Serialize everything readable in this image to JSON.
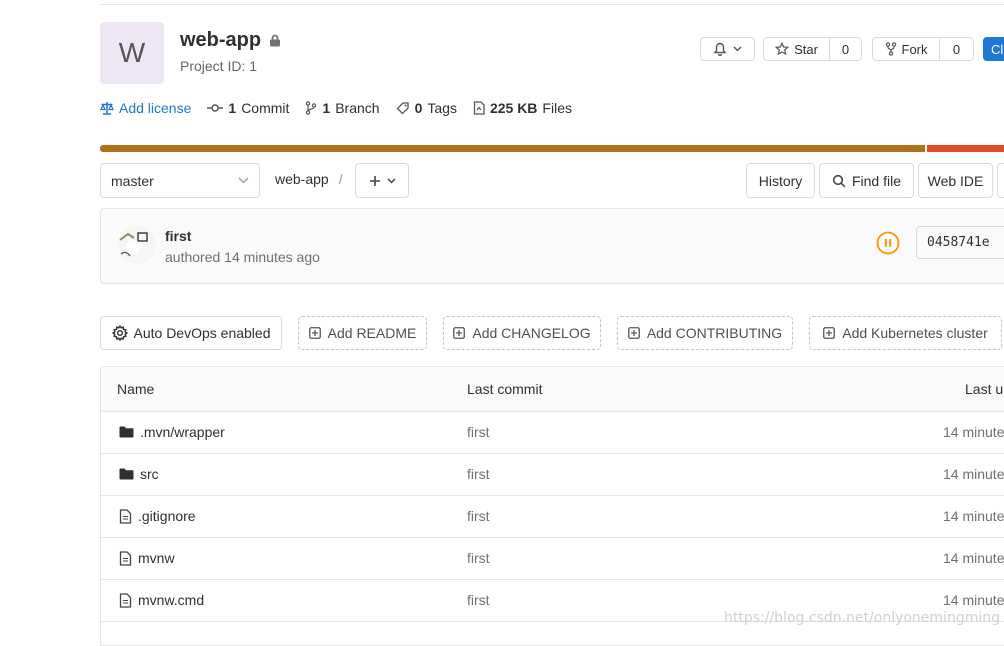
{
  "project": {
    "avatar_letter": "W",
    "name": "web-app",
    "id_text": "Project ID: 1"
  },
  "actions": {
    "star_label": "Star",
    "star_count": "0",
    "fork_label": "Fork",
    "fork_count": "0",
    "clone_partial": "Cl"
  },
  "stats": {
    "add_license": "Add license",
    "commits_num": "1",
    "commits_label": "Commit",
    "branches_num": "1",
    "branches_label": "Branch",
    "tags_num": "0",
    "tags_label": "Tags",
    "files_size": "225 KB",
    "files_label": "Files"
  },
  "language_colors": {
    "java": "#b07219",
    "html": "#e34c26"
  },
  "toolbar": {
    "branch": "master",
    "path": "web-app",
    "separator": "/",
    "history": "History",
    "find_file": "Find file",
    "web_ide": "Web IDE"
  },
  "commit": {
    "title": "first",
    "meta": "authored 14 minutes ago",
    "sha": "0458741e",
    "pipeline_color": "#fc9403"
  },
  "quick_actions": {
    "auto_devops": "Auto DevOps enabled",
    "add_readme": "Add README",
    "add_changelog": "Add CHANGELOG",
    "add_contributing": "Add CONTRIBUTING",
    "add_k8s": "Add Kubernetes cluster"
  },
  "table": {
    "headers": {
      "name": "Name",
      "last_commit": "Last commit",
      "last_update": "Last u"
    },
    "rows": [
      {
        "icon": "folder-icon",
        "name": ".mvn/wrapper",
        "commit": "first",
        "time": "14 minute"
      },
      {
        "icon": "folder-icon",
        "name": "src",
        "commit": "first",
        "time": "14 minute"
      },
      {
        "icon": "file-icon",
        "name": ".gitignore",
        "commit": "first",
        "time": "14 minute"
      },
      {
        "icon": "file-icon",
        "name": "mvnw",
        "commit": "first",
        "time": "14 minute"
      },
      {
        "icon": "file-icon",
        "name": "mvnw.cmd",
        "commit": "first",
        "time": "14 minute"
      }
    ]
  },
  "watermark": "https://blog.csdn.net/onlyonemingming"
}
